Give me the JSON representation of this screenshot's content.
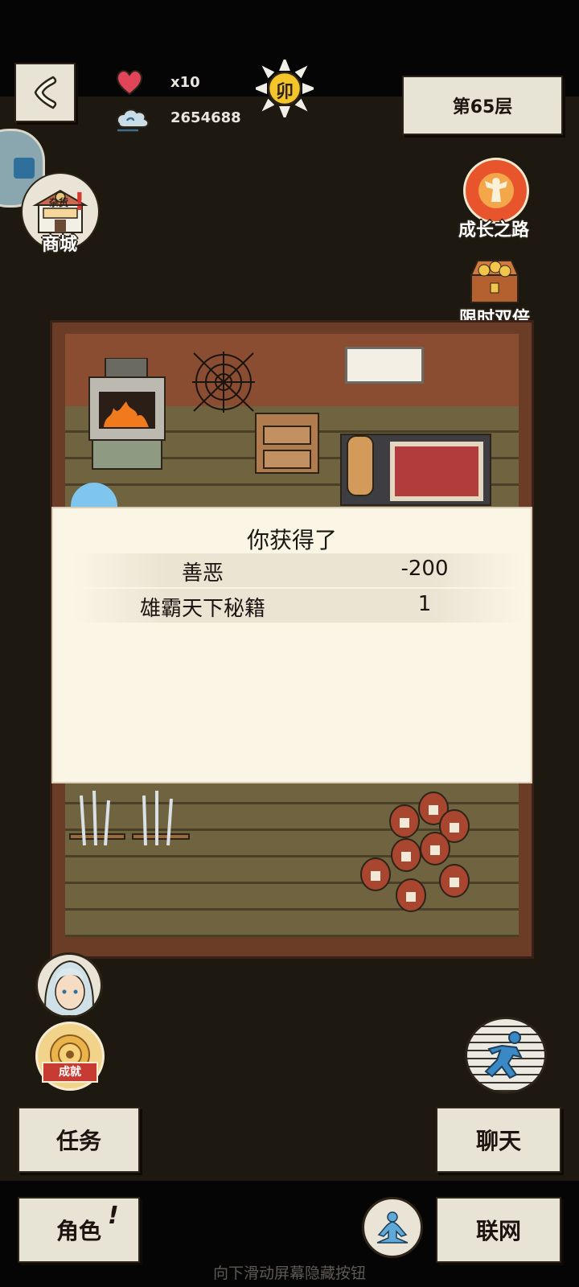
{
  "hud": {
    "lives_label": "x10",
    "currency_value": "2654688",
    "time_badge": "卯",
    "floor_label": "第65层"
  },
  "side_menu": {
    "shop_label": "商城",
    "shop_sign": "杂货",
    "growth_label": "成长之路",
    "double_label": "限时双倍",
    "achievement_label": "成就"
  },
  "dialog": {
    "title": "你获得了",
    "rewards": [
      {
        "name": "善恶",
        "value": "-200"
      },
      {
        "name": "雄霸天下秘籍",
        "value": "1"
      }
    ]
  },
  "buttons": {
    "task": "任务",
    "chat": "聊天",
    "role": "角色",
    "role_badge": "!",
    "network": "联网"
  },
  "hint": "向下滑动屏幕隐藏按钮",
  "colors": {
    "background": "#1d1810",
    "paper": "#e7e3d5",
    "dialog": "#fbf5e6",
    "heart": "#e0455a"
  }
}
